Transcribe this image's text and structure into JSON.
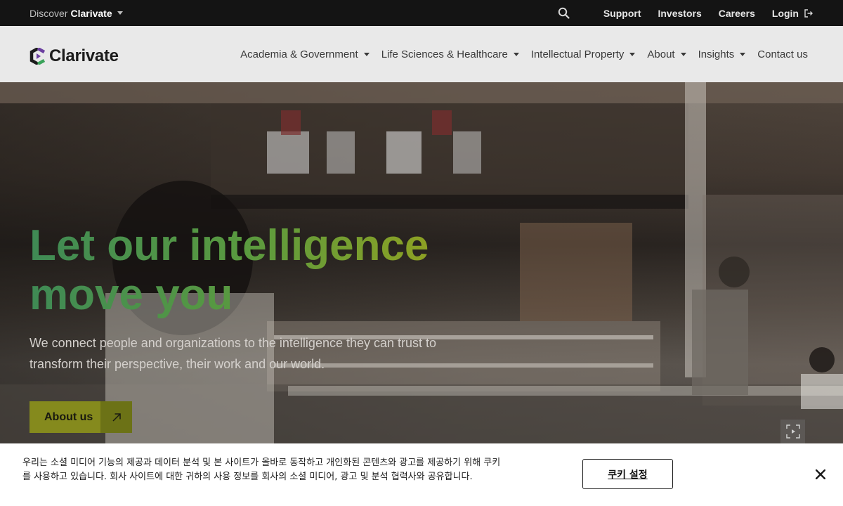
{
  "topbar": {
    "discover_prefix": "Discover",
    "discover_brand": "Clarivate",
    "links": [
      "Support",
      "Investors",
      "Careers",
      "Login"
    ]
  },
  "nav": {
    "logo_text": "Clarivate",
    "items": [
      {
        "label": "Academia & Government",
        "dropdown": true
      },
      {
        "label": "Life Sciences & Healthcare",
        "dropdown": true
      },
      {
        "label": "Intellectual Property",
        "dropdown": true
      },
      {
        "label": "About",
        "dropdown": true
      },
      {
        "label": "Insights",
        "dropdown": true
      },
      {
        "label": "Contact us",
        "dropdown": false
      }
    ]
  },
  "hero": {
    "title_line1": "Let our intelligence",
    "title_line2": "move you",
    "subtitle": "We connect people and organizations to the intelligence they can trust to transform their perspective, their work and our world.",
    "cta_label": "About us"
  },
  "cookie": {
    "text": "우리는 소셜 미디어 기능의 제공과 데이터 분석 및 본 사이트가 올바로 동작하고 개인화된 콘텐츠와 광고를 제공하기 위해 쿠키를 사용하고 있습니다. 회사 사이트에 대한 귀하의 사용 정보를 회사의 소셜 미디어, 광고 및 분석 협력사와 공유합니다.",
    "settings_label": "쿠키 설정"
  },
  "colors": {
    "topbar_bg": "#141414",
    "nav_bg": "#e9e9e9",
    "cta_bg": "#858a1d",
    "title_gradient_start": "#3f8a55",
    "title_gradient_end": "#97a21e"
  },
  "icons": {
    "search": "search-icon",
    "login": "login-icon",
    "cta_arrow": "arrow-up-right-icon",
    "expand": "expand-icon",
    "close": "close-icon",
    "logo": "clarivate-logo-mark"
  }
}
